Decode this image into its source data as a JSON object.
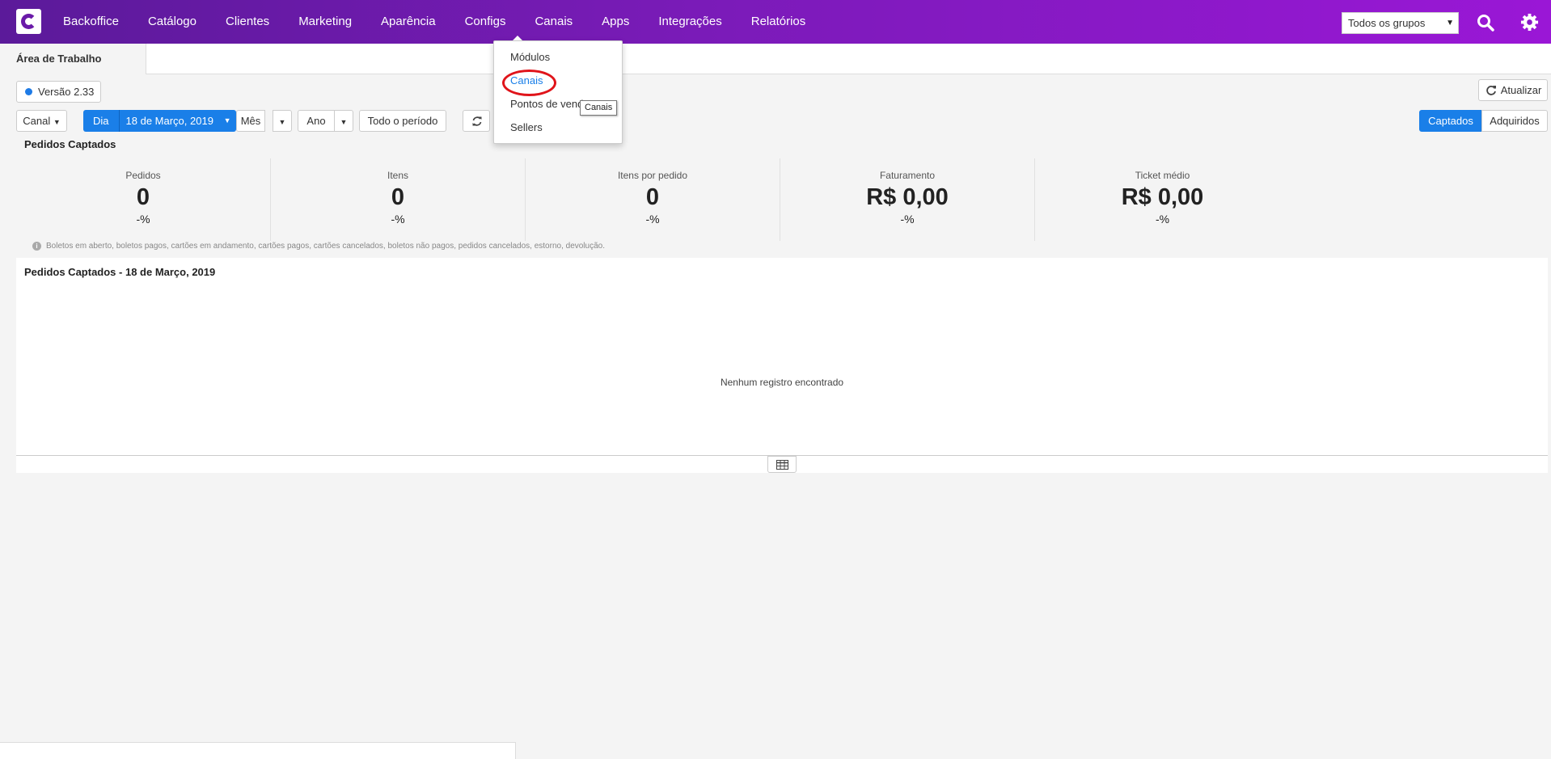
{
  "nav": {
    "items": [
      "Backoffice",
      "Catálogo",
      "Clientes",
      "Marketing",
      "Aparência",
      "Configs",
      "Canais",
      "Apps",
      "Integrações",
      "Relatórios"
    ],
    "group_select": "Todos os grupos"
  },
  "tab": {
    "label": "Área de Trabalho"
  },
  "toolbar": {
    "version": "Versão 2.33",
    "refresh": "Atualizar",
    "channel": "Canal",
    "day": "Dia",
    "date": "18 de Março, 2019",
    "month": "Mês",
    "year": "Ano",
    "all_period": "Todo o período",
    "captados": "Captados",
    "adquiridos": "Adquiridos"
  },
  "section_title": "Pedidos Captados",
  "stats": [
    {
      "label": "Pedidos",
      "value": "0",
      "pct": "-%"
    },
    {
      "label": "Itens",
      "value": "0",
      "pct": "-%"
    },
    {
      "label": "Itens por pedido",
      "value": "0",
      "pct": "-%"
    },
    {
      "label": "Faturamento",
      "value": "R$ 0,00",
      "pct": "-%"
    },
    {
      "label": "Ticket médio",
      "value": "R$ 0,00",
      "pct": "-%"
    }
  ],
  "note": "Boletos em aberto, boletos pagos, cartões em andamento, cartões pagos, cartões cancelados, boletos não pagos, pedidos cancelados, estorno, devolução.",
  "chart": {
    "title": "Pedidos Captados - 18 de Março, 2019",
    "empty": "Nenhum registro encontrado"
  },
  "dropdown": {
    "items": [
      "Módulos",
      "Canais",
      "Pontos de venda",
      "Sellers"
    ],
    "tooltip": "Canais"
  },
  "colors": {
    "nav_start": "#5b1a9a",
    "nav_end": "#9a17d6",
    "accent": "#1a7fe8",
    "highlight_circle": "#e0141a"
  }
}
